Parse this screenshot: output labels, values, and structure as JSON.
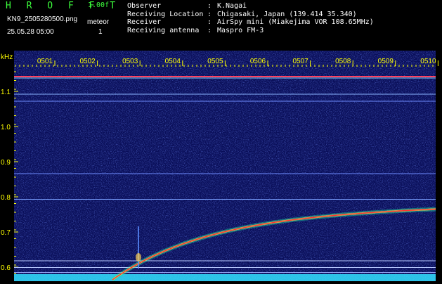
{
  "header": {
    "logo": "H R O F F T",
    "version": "1.00f",
    "filename": "KN9_2505280500.png",
    "datetime": "25.05.28 05:00",
    "meteor_label": "meteor",
    "meteor_count": "1"
  },
  "station_info": [
    {
      "key": "Observer",
      "sep": ":",
      "value": "K.Nagai"
    },
    {
      "key": "Receiving Location",
      "sep": ":",
      "value": "Chigasaki, Japan (139.414 35.340)"
    },
    {
      "key": "Receiver",
      "sep": ":",
      "value": "AirSpy mini (Miakejima VOR 108.65MHz)"
    },
    {
      "key": "Receiving antenna",
      "sep": ":",
      "value": "Maspro FM-3"
    }
  ],
  "spectrogram": {
    "unit_label": "kHz",
    "time_labels": [
      "0501",
      "0502",
      "0503",
      "0504",
      "0505",
      "0506",
      "0507",
      "0508",
      "0509",
      "0510"
    ],
    "freq_labels": [
      "1.1",
      "1.0",
      "0.9",
      "0.8",
      "0.7",
      "0.6"
    ],
    "colors": {
      "background": "#0a0f5a",
      "label": "#ffff00",
      "trace": "#ff3030",
      "floor": "#33e0ff"
    }
  }
}
